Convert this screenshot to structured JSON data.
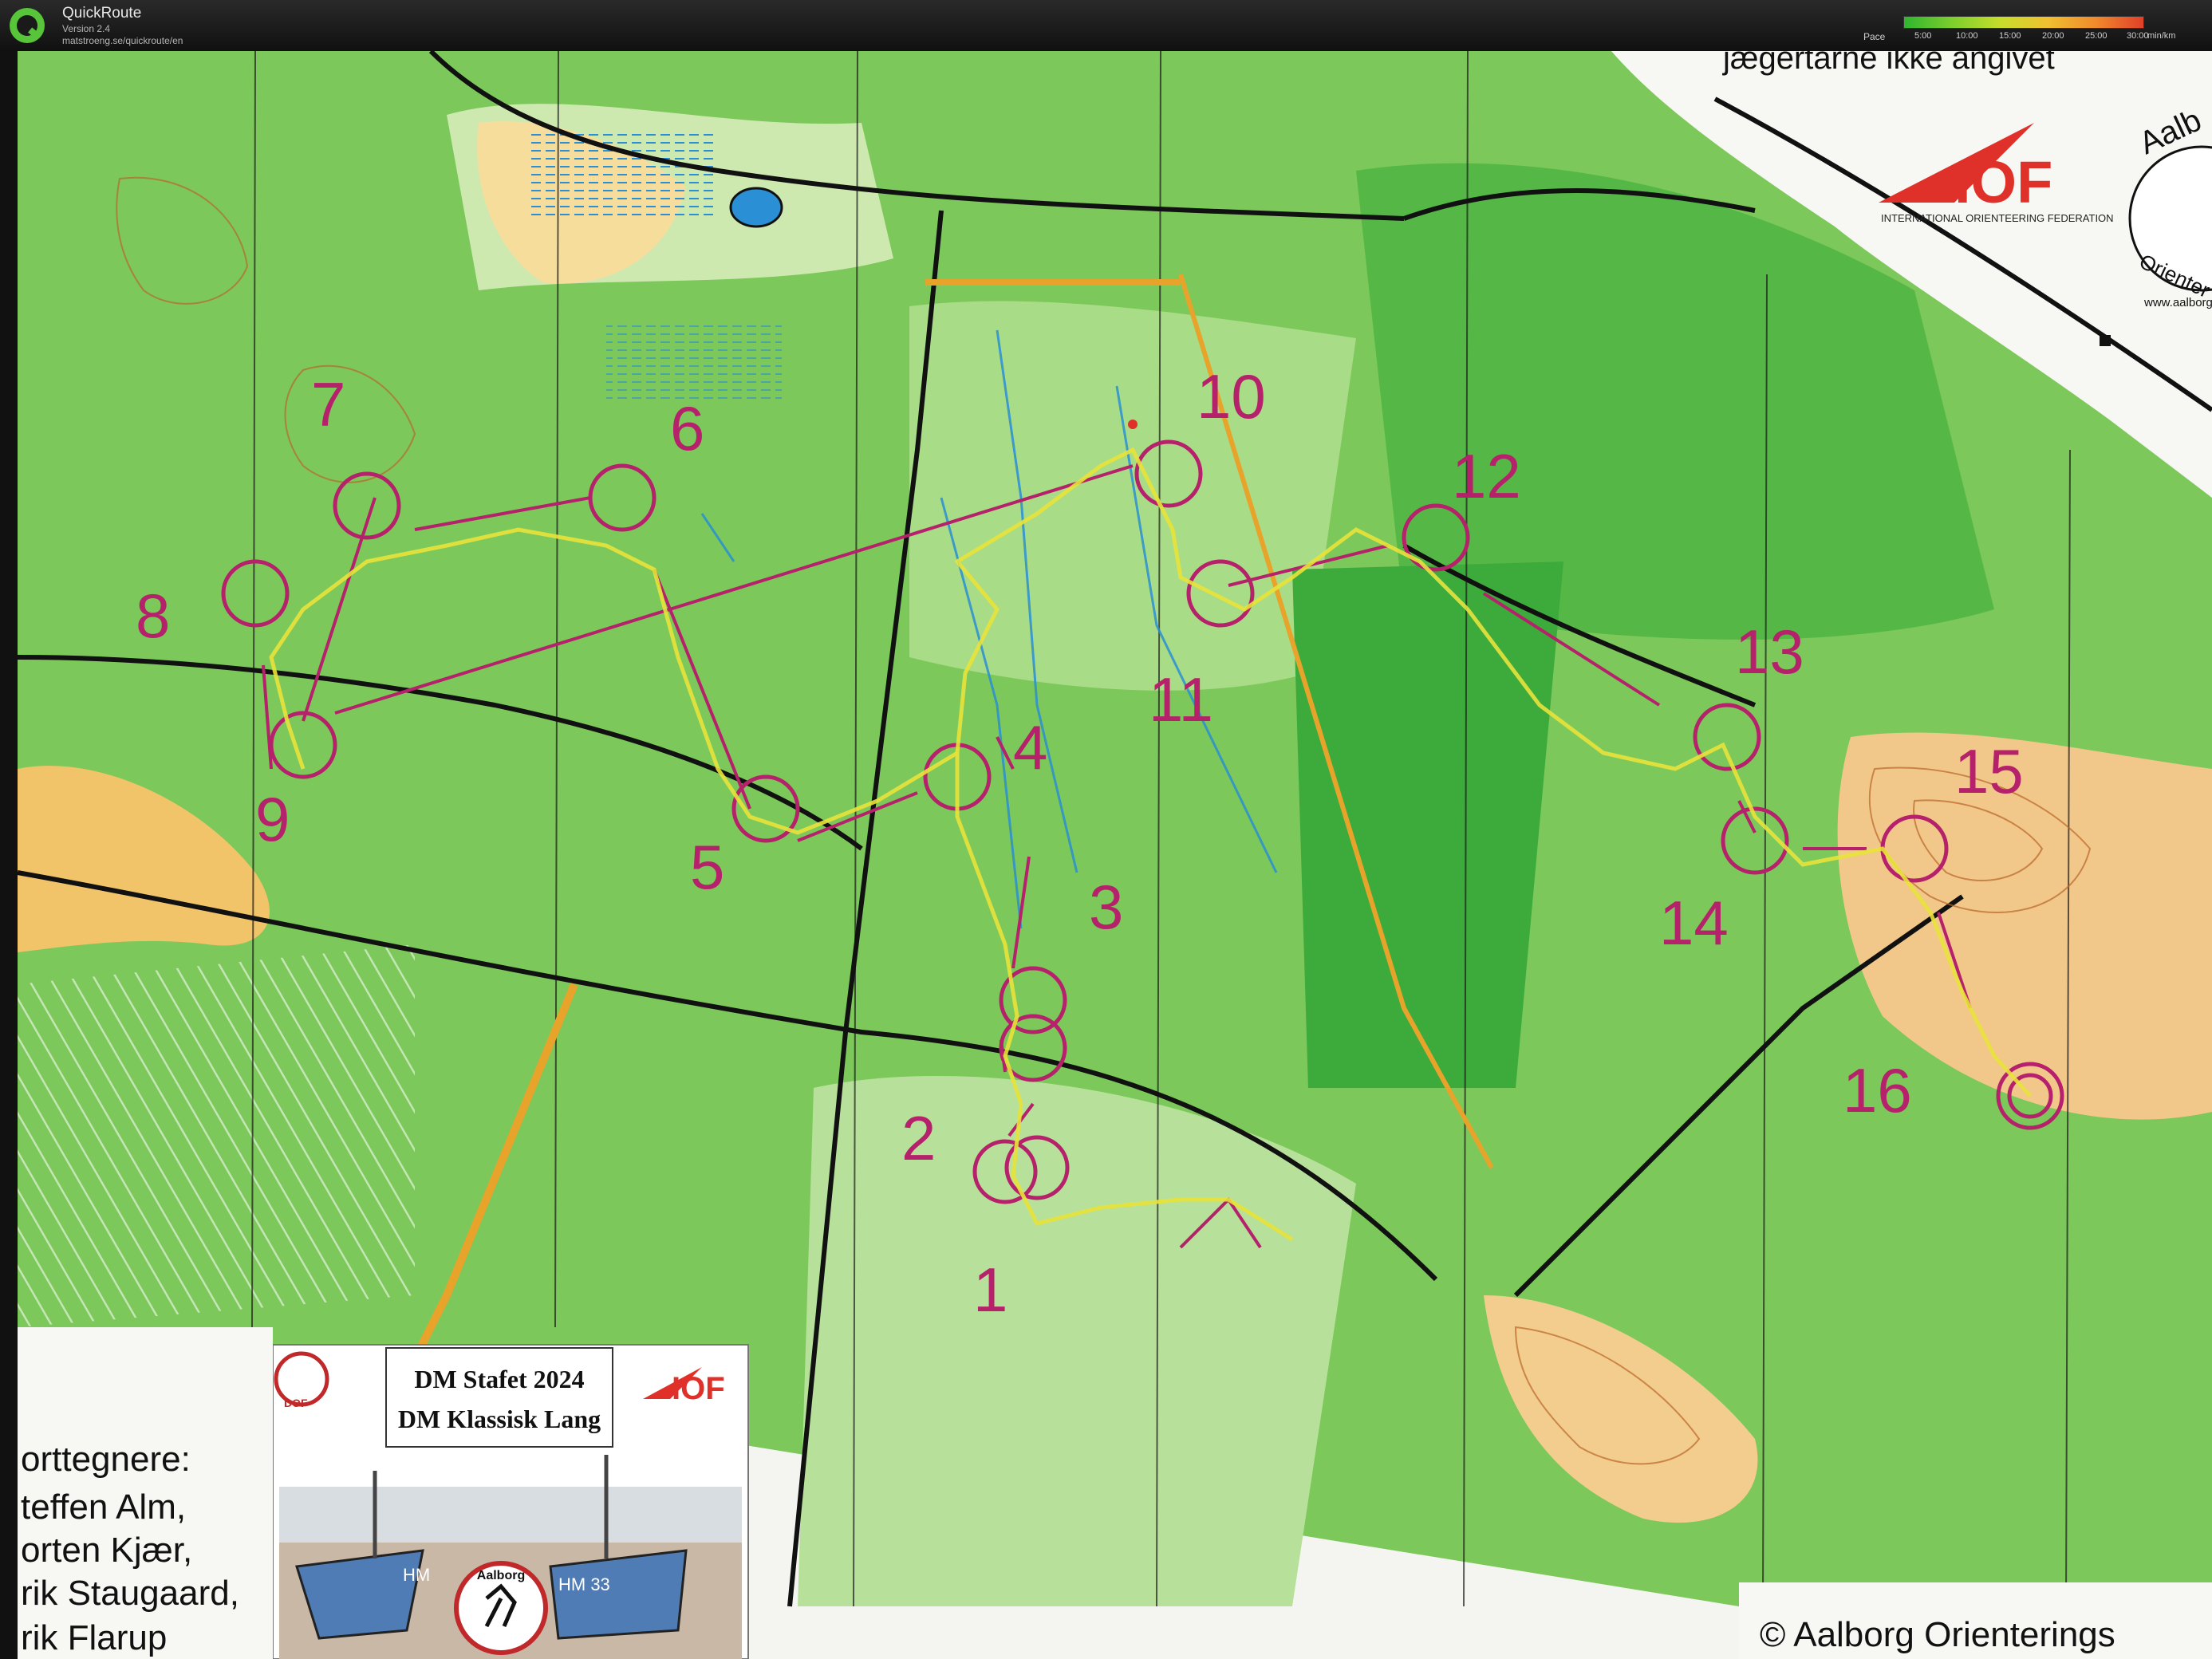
{
  "app": {
    "name": "QuickRoute",
    "version": "Version 2.4",
    "url": "matstroeng.se/quickroute/en"
  },
  "pace_legend": {
    "label": "Pace",
    "ticks": [
      "5:00",
      "10:00",
      "15:00",
      "20:00",
      "25:00",
      "30:00"
    ],
    "unit": "min/km",
    "colors": [
      "#2fb52f",
      "#7ccf2d",
      "#c6dd2c",
      "#f0c030",
      "#f08a2c",
      "#e0402a"
    ]
  },
  "map": {
    "header_text": "jægertårne ikke angivet",
    "iof_text": "IOF",
    "iof_caption": "INTERNATIONAL ORIENTEERING FEDERATION",
    "club_partial_top": "Aalb",
    "club_partial_ring": "Orienter",
    "club_web_partial": "www.aalborg",
    "copyright": "© Aalborg Orienterings",
    "controls": [
      "1",
      "2",
      "3",
      "4",
      "5",
      "6",
      "7",
      "8",
      "9",
      "10",
      "11",
      "12",
      "13",
      "14",
      "15",
      "16"
    ],
    "inset": {
      "title_line1": "DM Stafet 2024",
      "title_line2": "DM Klassisk Lang",
      "logo_text": "DOF",
      "iof_text": "IOF",
      "boat1": "HM",
      "boat2": "HM 33",
      "badge_text": "Aalborg"
    },
    "mappers": {
      "heading": "orttegnere:",
      "names": [
        "teffen Alm,",
        "orten Kjær,",
        "rik Staugaard,",
        "rik Flarup"
      ]
    },
    "colors": {
      "forest_light": "#cde9b0",
      "forest_mid": "#7cc85a",
      "forest_dark": "#3daa3c",
      "open_yellow": "#f2c46a",
      "course_magenta": "#b5216b",
      "route_yellow": "#e8e23a",
      "contour_brown": "#b8662a",
      "water_blue": "#2a8fd4"
    }
  }
}
